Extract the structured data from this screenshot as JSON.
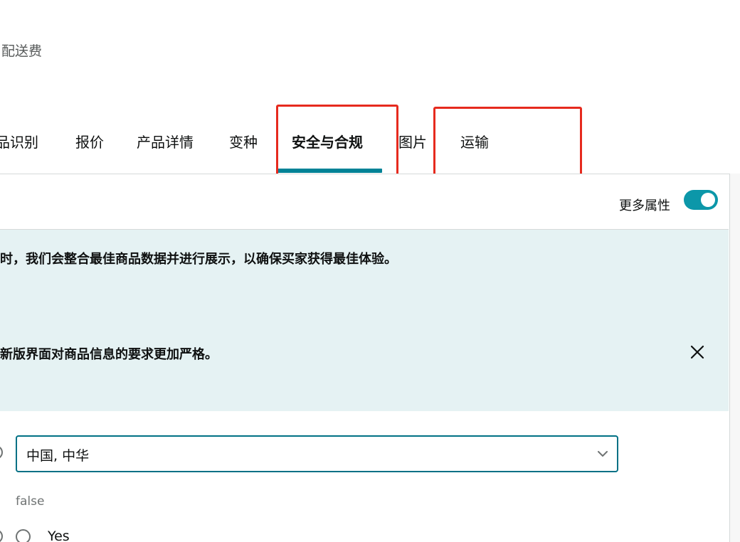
{
  "header": {
    "shipping_text": "配送费"
  },
  "tabs": [
    {
      "label": "品识别",
      "active": false
    },
    {
      "label": "报价",
      "active": false
    },
    {
      "label": "产品详情",
      "active": false
    },
    {
      "label": "变种",
      "active": false
    },
    {
      "label": "安全与合规",
      "active": true
    },
    {
      "label": "图片",
      "active": false
    },
    {
      "label": "运输",
      "active": false
    }
  ],
  "colors": {
    "accent": "#008296",
    "toggle": "#0c97a9",
    "highlight": "#e62a1e",
    "notice_bg": "#e5f2f3"
  },
  "toolbar": {
    "more_attributes_label": "更多属性",
    "more_attributes_on": true
  },
  "notice": {
    "line1": "时，我们会整合最佳商品数据并进行展示，以确保买家获得最佳体验。",
    "line2": "新版界面对商品信息的要求更加严格。",
    "close_icon": "close-icon"
  },
  "form": {
    "country_select_value": "中国, 中华",
    "default_hint": "false",
    "yes_label": "Yes"
  }
}
